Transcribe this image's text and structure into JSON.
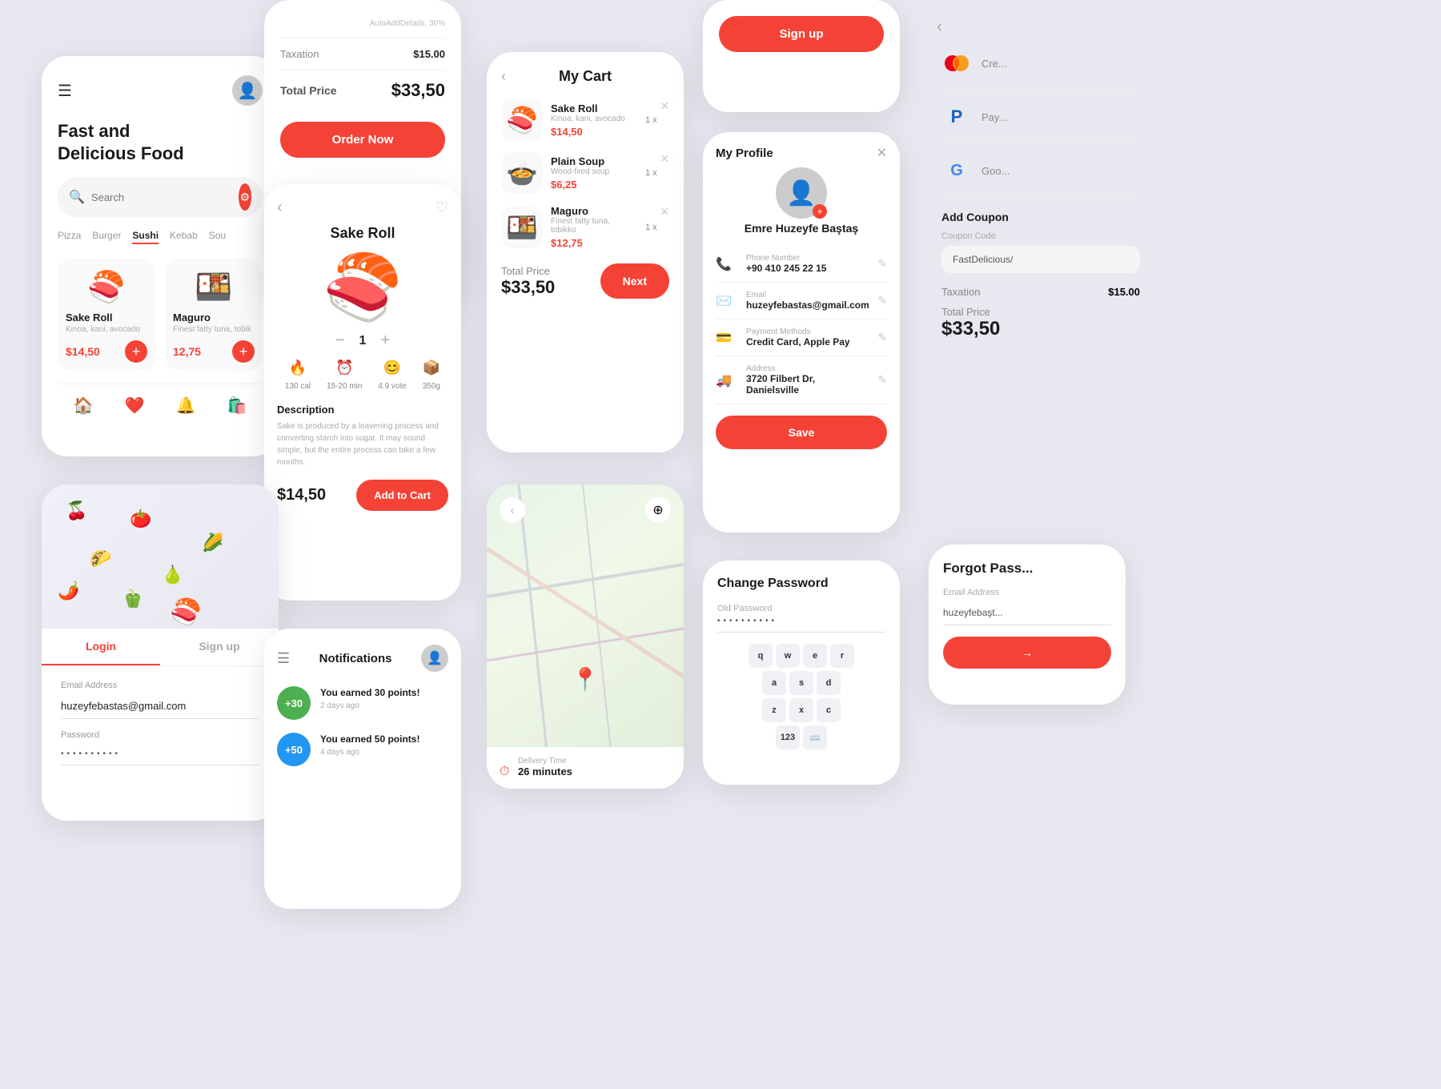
{
  "app": {
    "title": "Food Delivery App",
    "accent": "#F44336"
  },
  "card_main": {
    "header_icon": "☰",
    "avatar": "👤",
    "title_line1": "Fast and",
    "title_line2": "Delicious Food",
    "search_placeholder": "Search",
    "categories": [
      "Pizza",
      "Burger",
      "Sushi",
      "Kebab",
      "Sou"
    ],
    "active_category": "Sushi",
    "food_items": [
      {
        "name": "Sake Roll",
        "sub": "Kinoa, kani, avocado",
        "price": "$14,50",
        "emoji": "🍣"
      },
      {
        "name": "Maguro",
        "sub": "Finest fatty tuna, tobik",
        "price": "12,75",
        "emoji": "🍱"
      }
    ],
    "nav_items": [
      "🏠",
      "❤️",
      "🔔",
      "🛍️"
    ]
  },
  "card_order": {
    "items": [
      {
        "label": "AutoAddDetails,30%",
        "value": ""
      },
      {
        "label": "Taxation",
        "value": "$15.00"
      }
    ],
    "total_label": "Total Price",
    "total_price": "$33,50",
    "order_now": "Order Now"
  },
  "card_detail": {
    "title": "Sake Roll",
    "emoji": "🍣🍱",
    "qty": "1",
    "info": [
      {
        "icon": "🔥",
        "label": "130 cal"
      },
      {
        "icon": "⏰",
        "label": "15-20 min"
      },
      {
        "icon": "😊",
        "label": "4.9 vote"
      },
      {
        "icon": "📦",
        "label": "350g"
      }
    ],
    "desc_title": "Description",
    "desc_text": "Sake is produced by a leavening process and converting starch into sugar. It may sound simple, but the entire process can take a few months.",
    "price": "$14,50",
    "add_to_cart": "Add to Cart"
  },
  "card_cart": {
    "title": "My Cart",
    "items": [
      {
        "name": "Sake Roll",
        "sub": "Kinoa, kani, avocado",
        "price": "$14,50",
        "qty": "1 x",
        "emoji": "🍣"
      },
      {
        "name": "Plain Soup",
        "sub": "Wood-fired soup",
        "price": "$6,25",
        "qty": "1 x",
        "emoji": "🍲"
      },
      {
        "name": "Maguro",
        "sub": "Finest fatty tuna, tobikko",
        "price": "$12,75",
        "qty": "1 x",
        "emoji": "🍱"
      }
    ],
    "total_label": "Total Price",
    "total_price": "$33,50",
    "next_btn": "Next"
  },
  "card_signup": {
    "btn_label": "Sign up",
    "payment_methods": [
      {
        "name": "Cre...",
        "logo": "💳",
        "color": "#FF5722"
      },
      {
        "name": "Pay...",
        "logo": "🅿️",
        "color": "#1565C0"
      },
      {
        "name": "Goo...",
        "logo": "G",
        "color": "#4CAF50"
      }
    ]
  },
  "card_profile": {
    "title": "My Profile",
    "avatar": "👤",
    "name": "Emre Huzeyfe Baştaş",
    "fields": [
      {
        "label": "Phone Number",
        "value": "+90 410 245 22 15",
        "icon": "📞"
      },
      {
        "label": "Email",
        "value": "huzeyfebastas@gmail.com",
        "icon": "✉️"
      },
      {
        "label": "Payment Methods",
        "value": "Credit Card, Apple Pay",
        "icon": "💳"
      },
      {
        "label": "Address",
        "value": "3720 Filbert Dr, Danielsville",
        "icon": "🚚"
      }
    ],
    "save_btn": "Save"
  },
  "card_login": {
    "tabs": [
      "Login",
      "Sign up"
    ],
    "active_tab": "Login",
    "email_label": "Email Address",
    "email_value": "huzeyfebastas@gmail.com",
    "password_label": "Password",
    "password_value": "••••••••••"
  },
  "card_notif": {
    "title": "Notifications",
    "items": [
      {
        "badge": "+30",
        "badge_color": "badge-green",
        "text": "You earned 30 points!",
        "time": "2 days ago"
      },
      {
        "badge": "+50",
        "badge_color": "badge-blue",
        "text": "You earned 50 points!",
        "time": "4 days ago"
      }
    ]
  },
  "card_map": {
    "delivery_label": "Delivery Time",
    "delivery_value": "26 minutes"
  },
  "card_pwd": {
    "title": "Change Password",
    "old_label": "Old Password",
    "old_value": "••••••••••",
    "keyboard": {
      "row1": [
        "q",
        "w",
        "e",
        "r"
      ],
      "row2": [
        "a",
        "s",
        "d"
      ],
      "row3": [
        "z",
        "x",
        "c"
      ],
      "row_num": [
        "123",
        "⌨️"
      ]
    }
  },
  "coupon_panel": {
    "back_icon": "‹",
    "payment_methods": [
      {
        "name": "Cre...",
        "logo": "💳"
      },
      {
        "name": "Pay...",
        "logo": "🅿️"
      },
      {
        "name": "Goo...",
        "logo": "G"
      }
    ],
    "add_coupon_label": "Add Coupon",
    "coupon_code_label": "Coupon Code",
    "coupon_code_value": "FastDelicious/",
    "tax_label": "Taxation",
    "tax_value": "$15.00",
    "total_label": "Total Price",
    "total_price": "$33,50"
  },
  "forgot_panel": {
    "title": "Forgot Pass...",
    "email_label": "Email Address",
    "email_value": "huzeyfebaşt...",
    "send_btn_label": "→"
  }
}
